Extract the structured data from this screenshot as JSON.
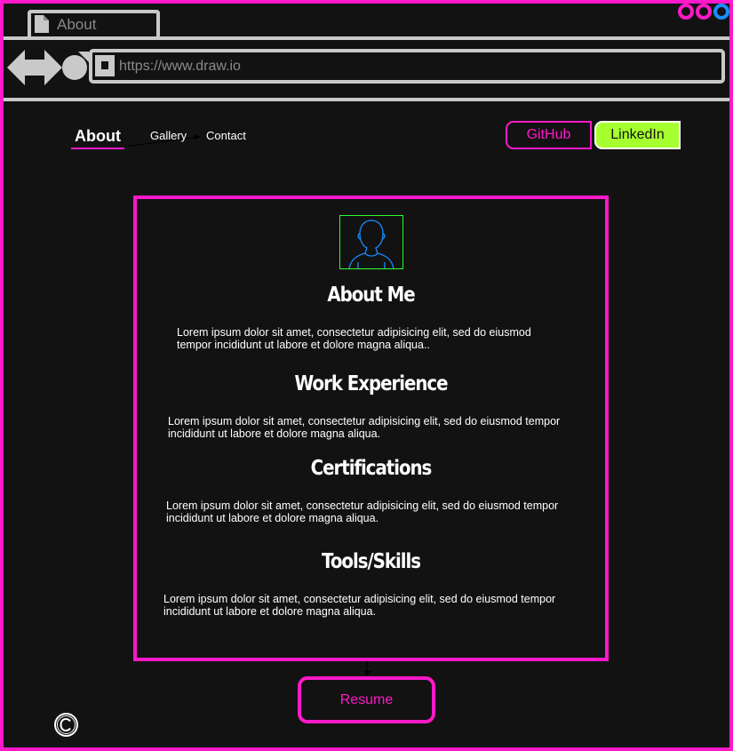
{
  "browser": {
    "tab_title": "About",
    "url": "https://www.draw.io",
    "icons": {
      "tab": "document-icon",
      "back": "back-arrow-icon",
      "forward": "forward-arrow-icon",
      "reload": "reload-icon",
      "lock": "lock-icon"
    },
    "window_controls": [
      "minimize",
      "maximize",
      "close"
    ]
  },
  "nav": {
    "links": [
      {
        "label": "About",
        "active": true
      },
      {
        "label": "Gallery",
        "active": false
      },
      {
        "label": "Contact",
        "active": false
      }
    ],
    "github_label": "GitHub",
    "linkedin_label": "LinkedIn"
  },
  "main": {
    "avatar_icon": "user-avatar-icon",
    "sections": [
      {
        "title": "About Me",
        "text": "Lorem ipsum dolor sit amet, consectetur adipisicing elit, sed do eiusmod tempor incididunt ut labore et dolore magna aliqua.."
      },
      {
        "title": "Work Experience",
        "text": "Lorem ipsum dolor sit amet, consectetur adipisicing elit, sed do eiusmod tempor incididunt ut labore et dolore magna aliqua."
      },
      {
        "title": "Certifications",
        "text": "Lorem ipsum dolor sit amet, consectetur adipisicing elit, sed do eiusmod tempor incididunt ut labore et dolore magna aliqua."
      },
      {
        "title": "Tools/Skills",
        "text": "Lorem ipsum dolor sit amet, consectetur adipisicing elit, sed do eiusmod tempor incididunt ut labore et dolore magna aliqua."
      }
    ]
  },
  "footer": {
    "resume_label": "Resume",
    "copyright_icon": "copyright-icon"
  },
  "colors": {
    "background": "#121212",
    "accent_pink": "#ff19c8",
    "accent_green": "#a6ff2e",
    "chrome_gray": "#c9c9c9",
    "window_blue": "#1a8cff"
  }
}
